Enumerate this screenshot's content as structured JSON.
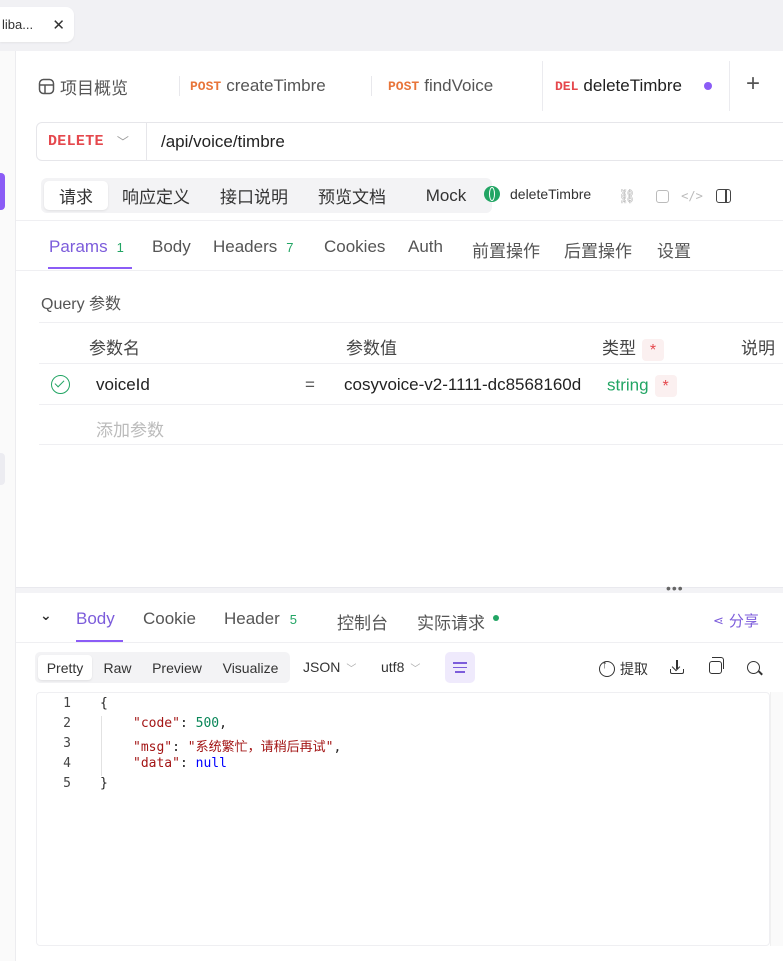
{
  "browser_tab": {
    "title": "liba...",
    "close": "✕"
  },
  "api_tabs": [
    {
      "method": "",
      "label": "项目概览",
      "icon": "overview-icon"
    },
    {
      "method": "POST",
      "label": "createTimbre",
      "method_color": "#e8753a"
    },
    {
      "method": "POST",
      "label": "findVoice",
      "method_color": "#e8753a"
    },
    {
      "method": "DEL",
      "label": "deleteTimbre",
      "method_color": "#e5484d"
    }
  ],
  "add_tab": "+",
  "request": {
    "method": "DELETE",
    "url": "/api/voice/timbre"
  },
  "sub_tabs": [
    "请求",
    "响应定义",
    "接口说明",
    "预览文档",
    "Mock"
  ],
  "api_name": "deleteTimbre",
  "param_tabs": [
    {
      "label": "Params",
      "count": "1"
    },
    {
      "label": "Body",
      "count": ""
    },
    {
      "label": "Headers",
      "count": "7"
    },
    {
      "label": "Cookies",
      "count": ""
    },
    {
      "label": "Auth",
      "count": ""
    },
    {
      "label": "前置操作",
      "count": ""
    },
    {
      "label": "后置操作",
      "count": ""
    },
    {
      "label": "设置",
      "count": ""
    }
  ],
  "query": {
    "title": "Query 参数",
    "headers": {
      "name": "参数名",
      "value": "参数值",
      "type": "类型",
      "required": "*",
      "desc": "说明"
    },
    "rows": [
      {
        "name": "voiceId",
        "op": "=",
        "value": "cosyvoice-v2-1111-dc8568160d",
        "type": "string",
        "required": "*"
      }
    ],
    "add_placeholder": "添加参数"
  },
  "split_handle": "•••",
  "response_tabs": [
    {
      "label": "Body",
      "count": ""
    },
    {
      "label": "Cookie",
      "count": ""
    },
    {
      "label": "Header",
      "count": "5"
    },
    {
      "label": "控制台",
      "count": ""
    },
    {
      "label": "实际请求",
      "count": ""
    }
  ],
  "share_label": "分享",
  "format_tabs": [
    "Pretty",
    "Raw",
    "Preview",
    "Visualize"
  ],
  "format_dropdown": "JSON",
  "encoding_dropdown": "utf8",
  "extract_label": "提取",
  "code_lines": [
    {
      "no": "1",
      "text": "{"
    },
    {
      "no": "2",
      "key": "\"code\"",
      "val": "500",
      "val_type": "number",
      "trail": ","
    },
    {
      "no": "3",
      "key": "\"msg\"",
      "val": "\"系统繁忙，请稍后再试\"",
      "val_type": "string",
      "trail": ","
    },
    {
      "no": "4",
      "key": "\"data\"",
      "val": "null",
      "val_type": "null",
      "trail": ""
    },
    {
      "no": "5",
      "text": "}"
    }
  ],
  "colors": {
    "accent": "#8b5cf6",
    "delete": "#e5484d",
    "post": "#e8753a",
    "green": "#22a564"
  }
}
